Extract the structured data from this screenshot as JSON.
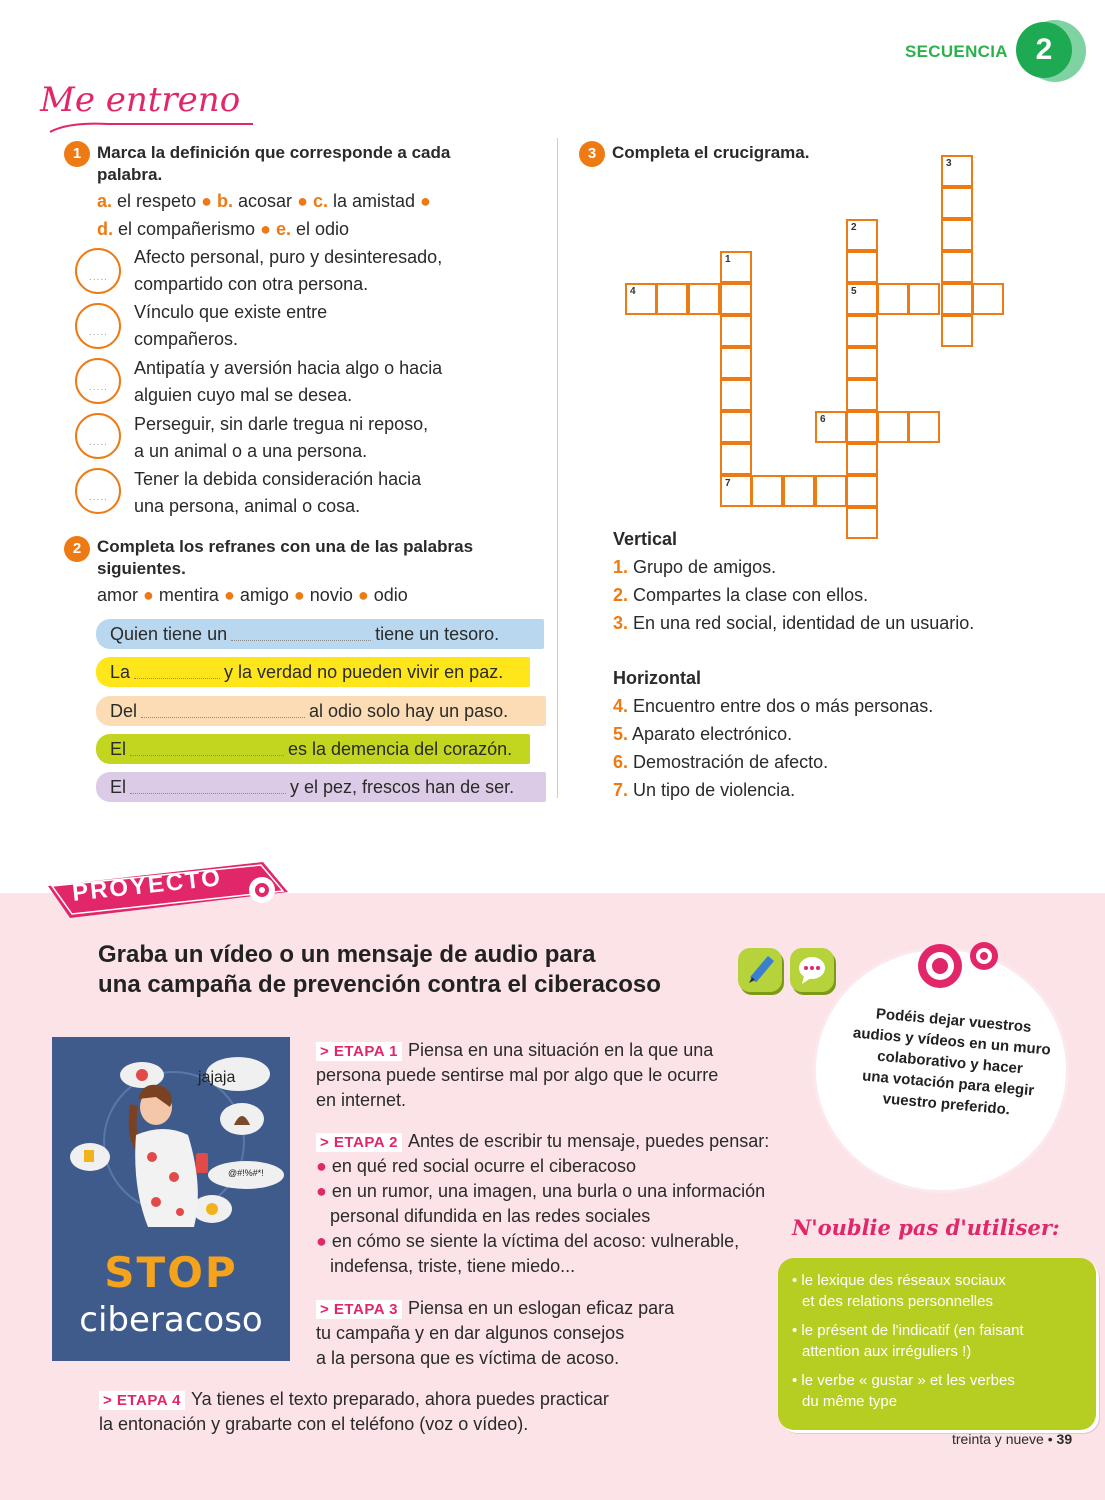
{
  "header": {
    "sequence_label": "SECUENCIA",
    "sequence_number": "2"
  },
  "section_title": "Me entreno",
  "exercise1": {
    "number": "1",
    "title_line1": "Marca la definición que corresponde a cada",
    "title_line2": "palabra.",
    "options": [
      {
        "letter": "a.",
        "word": "el respeto"
      },
      {
        "letter": "b.",
        "word": "acosar"
      },
      {
        "letter": "c.",
        "word": "la amistad"
      },
      {
        "letter": "d.",
        "word": "el compañerismo"
      },
      {
        "letter": "e.",
        "word": "el odio"
      }
    ],
    "separator": "●",
    "answer_placeholder": ".....",
    "definitions": [
      {
        "line1": "Afecto personal, puro y desinteresado,",
        "line2": "compartido con otra persona."
      },
      {
        "line1": "Vínculo que existe entre",
        "line2": "compañeros."
      },
      {
        "line1": "Antipatía y aversión hacia algo o hacia",
        "line2": "alguien cuyo mal se desea."
      },
      {
        "line1": "Perseguir, sin darle tregua ni reposo,",
        "line2": "a un animal o a una persona."
      },
      {
        "line1": "Tener la debida consideración hacia",
        "line2": "una persona, animal o cosa."
      }
    ]
  },
  "exercise2": {
    "number": "2",
    "title_line1": "Completa los refranes con una de las palabras",
    "title_line2": "siguientes.",
    "words": [
      "amor",
      "mentira",
      "amigo",
      "novio",
      "odio"
    ],
    "proverbs": [
      {
        "before": "Quien tiene un",
        "after": "tiene un tesoro.",
        "color": "#b9d8ef"
      },
      {
        "before": "La",
        "after": "y la verdad no pueden vivir en paz.",
        "color": "#ffe61a"
      },
      {
        "before": "Del",
        "after": "al odio solo hay un paso.",
        "color": "#fbdcb5"
      },
      {
        "before": "El",
        "after": "es la demencia del corazón.",
        "color": "#c3d61f"
      },
      {
        "before": "El",
        "after": "y el pez, frescos han de ser.",
        "color": "#dccbe6"
      }
    ]
  },
  "exercise3": {
    "number": "3",
    "title": "Completa el crucigrama.",
    "cell_numbers": [
      "1",
      "2",
      "3",
      "4",
      "5",
      "6",
      "7"
    ],
    "vertical_title": "Vertical",
    "vertical": [
      {
        "n": "1.",
        "text": "Grupo de amigos."
      },
      {
        "n": "2.",
        "text": "Compartes la clase con ellos."
      },
      {
        "n": "3.",
        "text": "En una red social, identidad de un usuario."
      }
    ],
    "horizontal_title": "Horizontal",
    "horizontal": [
      {
        "n": "4.",
        "text": "Encuentro entre dos o más personas."
      },
      {
        "n": "5.",
        "text": "Aparato electrónico."
      },
      {
        "n": "6.",
        "text": "Demostración de afecto."
      },
      {
        "n": "7.",
        "text": "Un tipo de violencia."
      }
    ]
  },
  "project": {
    "banner": "PROYECTO",
    "title_line1": "Graba un vídeo o un mensaje de audio para",
    "title_line2": "una campaña de prevención contra el ciberacoso",
    "poster": {
      "bubble_text": "jajaja",
      "symbols_text": "@#!%#*!",
      "stop": "STOP",
      "ciberacoso": "ciberacoso"
    },
    "etapas": [
      {
        "tag": "> ETAPA 1",
        "lines": [
          "Piensa en una situación en la que una",
          "persona puede sentirse mal por algo que le ocurre",
          "en internet."
        ]
      },
      {
        "tag": "> ETAPA 2",
        "lines": [
          "Antes de escribir tu mensaje, puedes pensar:"
        ],
        "bullets": [
          {
            "line1": "en qué red social ocurre el ciberacoso",
            "line2": ""
          },
          {
            "line1": "en un rumor, una imagen, una burla o una información",
            "line2": "personal difundida en las redes sociales"
          },
          {
            "line1": "en cómo se siente la víctima del acoso: vulnerable,",
            "line2": "indefensa, triste, tiene miedo..."
          }
        ]
      },
      {
        "tag": "> ETAPA 3",
        "lines": [
          "Piensa en un eslogan eficaz para",
          "tu campaña y en dar algunos consejos",
          "a la persona que es víctima de acoso."
        ]
      },
      {
        "tag": "> ETAPA 4",
        "lines": [
          "Ya tienes el texto preparado, ahora puedes practicar",
          "la entonación y grabarte con el teléfono (voz o vídeo)."
        ]
      }
    ],
    "bubble_lines": [
      "Podéis dejar vuestros",
      "audios y vídeos en un muro",
      "colaborativo y hacer",
      "una votación para elegir",
      "vuestro preferido."
    ],
    "noublie_title": "N'oublie pas d'utiliser:",
    "noublie_items": [
      {
        "line1": "• le lexique des réseaux sociaux",
        "line2": "et des relations personnelles"
      },
      {
        "line1": "• le présent de l'indicatif (en faisant",
        "line2": "attention aux irréguliers !)"
      },
      {
        "line1": "• le verbe « gustar » et les verbes",
        "line2": "du même type"
      }
    ]
  },
  "footer": {
    "page_words": "treinta y nueve",
    "bullet": "•",
    "page_number": "39"
  },
  "colors": {
    "accent_orange": "#ee7a14",
    "magenta": "#e2266a",
    "green": "#1daa52",
    "lime": "#b6cd22",
    "pink_bg": "#fbe3e8"
  }
}
